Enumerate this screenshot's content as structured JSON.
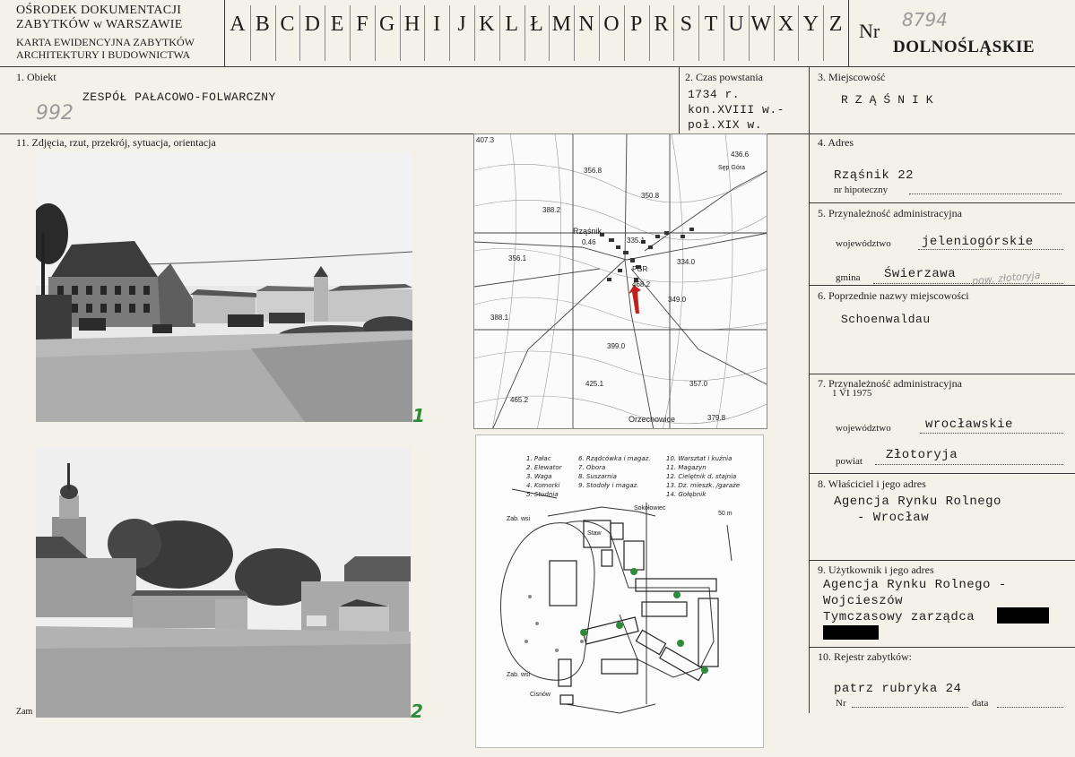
{
  "header": {
    "org_line1": "OŚRODEK DOKUMENTACJI",
    "org_line2": "ZABYTKÓW w WARSZAWIE",
    "card_line1": "KARTA EWIDENCYJNA ZABYTKÓW",
    "card_line2": "ARCHITEKTURY I BUDOWNICTWA",
    "letters": [
      "A",
      "B",
      "C",
      "D",
      "E",
      "F",
      "G",
      "H",
      "I",
      "J",
      "K",
      "L",
      "Ł",
      "M",
      "N",
      "O",
      "P",
      "R",
      "S",
      "T",
      "U",
      "W",
      "X",
      "Y",
      "Z"
    ],
    "nr_label": "Nr",
    "nr_handwritten": "8794",
    "voivodeship": "DOLNOŚLĄSKIE"
  },
  "field1": {
    "label": "1. Obiekt",
    "value": "ZESPÓŁ PAŁACOWO-FOLWARCZNY",
    "handwritten": "992"
  },
  "field2": {
    "label": "2. Czas powstania",
    "line1": "1734 r.",
    "line2": "kon.XVIII w.-",
    "line3": "poł.XIX w."
  },
  "field3": {
    "label": "3. Miejscowość",
    "value": "RZĄŚNIK"
  },
  "field11": {
    "label": "11. Zdjęcia, rzut, przekrój, sytuacja, orientacja",
    "photo1_num": "1",
    "photo2_num": "2",
    "bottom_cut": "Zam"
  },
  "map": {
    "elevations": [
      "407.3",
      "356.8",
      "436.6",
      "388.2",
      "350.8",
      "335.1",
      "356.1",
      "334.0",
      "388.1",
      "349.0",
      "399.0",
      "425.1",
      "465.2",
      "357.0",
      "379.8"
    ],
    "place_rzasnik": "Rząśnik",
    "pgr": "PGR",
    "place_orzechowice": "Orzechowice",
    "number_046": "0.46",
    "number_468": "468.2",
    "top_road": "Sęp Góra"
  },
  "plan": {
    "legend": [
      "1. Pałac",
      "2. Elewator",
      "3. Waga",
      "4. Komorki",
      "5. Studnia",
      "6. Rządcówka i magaz.",
      "7. Obora",
      "8. Suszarnia",
      "9. Stodoły i magaz.",
      "10. Warsztat i kuźnia",
      "11. Magazyn",
      "12. Cielętnik d. stajnia",
      "13. Dz. mieszk. /garaże",
      "14. Gołębnik"
    ],
    "sokolowiec": "Sokołowiec",
    "zab_wsi_1": "Zab. wsi",
    "zab_wsi_2": "Zab. wsi",
    "staw": "Staw",
    "scale": "50 m",
    "bottom_road": "Cisnów"
  },
  "field4": {
    "label": "4. Adres",
    "value": "Rząśnik 22",
    "hip_label": "nr hipoteczny"
  },
  "field5": {
    "label": "5. Przynależność administracyjna",
    "woj_label": "województwo",
    "woj_value": "jeleniogórskie",
    "gmina_label": "gmina",
    "gmina_value": "Świerzawa",
    "pow_handwritten": "pow. złotoryja"
  },
  "field6": {
    "label": "6. Poprzednie nazwy miejscowości",
    "value": "Schoenwaldau"
  },
  "field7": {
    "label1": "7. Przynależność administracyjna",
    "label2": "1 VI 1975",
    "woj_label": "województwo",
    "woj_value": "wrocławskie",
    "powiat_label": "powiat",
    "powiat_value": "Złotoryja"
  },
  "field8": {
    "label": "8. Właściciel i jego adres",
    "line1": "Agencja Rynku Rolnego",
    "line2": "- Wrocław"
  },
  "field9": {
    "label": "9. Użytkownik i jego adres",
    "line1": "Agencja Rynku Rolnego -",
    "line2": "Wojcieszów",
    "line3": "Tymczasowy zarządca"
  },
  "field10": {
    "label": "10. Rejestr zabytków:",
    "value": "patrz rubryka 24",
    "nr_label": "Nr",
    "data_label": "data"
  }
}
